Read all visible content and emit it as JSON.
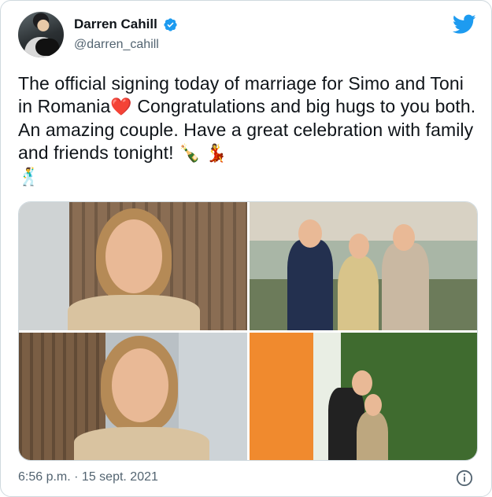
{
  "author": {
    "name": "Darren Cahill",
    "handle": "@darren_cahill"
  },
  "tweet": {
    "text_part1": "The official signing today of marriage for Simo and Toni in Romania",
    "heart": "❤️",
    "text_part2": " Congratulations and big hugs to you both. An amazing couple. Have a great celebration with family and friends tonight! ",
    "emoji_tail": [
      "🍾",
      "💃",
      "🕺"
    ]
  },
  "media": {
    "photos": [
      "photo-1",
      "photo-2",
      "photo-3",
      "photo-4"
    ]
  },
  "timestamp": "6:56 p.m. · 15 sept. 2021",
  "colors": {
    "twitter_blue": "#1d9bf0",
    "text": "#0f1419",
    "secondary": "#536471",
    "border": "#cfd9de"
  },
  "icons": {
    "verified": "verified-badge-icon",
    "brand": "twitter-bird-icon",
    "info": "info-icon"
  }
}
